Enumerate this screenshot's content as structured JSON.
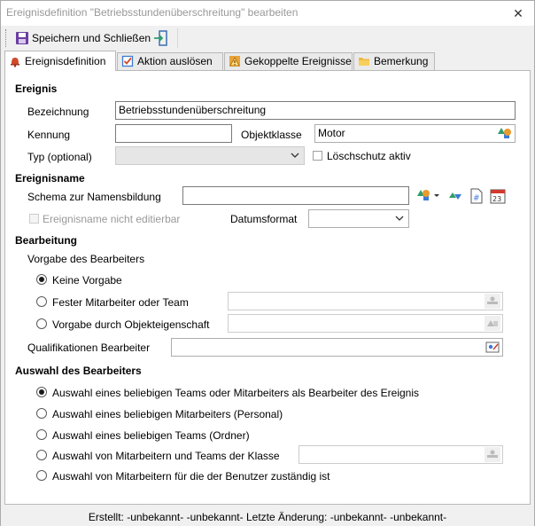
{
  "window": {
    "title": "Ereignisdefinition \"Betriebsstundenüberschreitung\" bearbeiten",
    "close_glyph": "✕"
  },
  "toolbar": {
    "save_label": "Speichern und Schließen",
    "save_icon": "floppy-disk-icon",
    "exit_icon": "exit-door-icon"
  },
  "tabs": [
    {
      "label": "Ereignisdefinition",
      "icon": "bell-icon",
      "active": true
    },
    {
      "label": "Aktion auslösen",
      "icon": "checkbox-icon",
      "active": false
    },
    {
      "label": "Gekoppelte Ereignisse",
      "icon": "warning-icon",
      "active": false
    },
    {
      "label": "Bemerkung",
      "icon": "folder-icon",
      "active": false
    }
  ],
  "ereignis": {
    "section": "Ereignis",
    "bezeichnung_label": "Bezeichnung",
    "bezeichnung_value": "Betriebsstundenüberschreitung",
    "kennung_label": "Kennung",
    "kennung_value": "",
    "objektklasse_label": "Objektklasse",
    "objektklasse_value": "Motor",
    "typ_label": "Typ (optional)",
    "typ_value": "",
    "loeschschutz_label": "Löschschutz aktiv",
    "loeschschutz_checked": false
  },
  "ereignisname": {
    "section": "Ereignisname",
    "schema_label": "Schema zur Namensbildung",
    "schema_value": "",
    "nicht_editierbar_label": "Ereignisname nicht editierbar",
    "datumsformat_label": "Datumsformat",
    "datumsformat_value": "",
    "calendar_day": "23"
  },
  "bearbeitung": {
    "section": "Bearbeitung",
    "vorgabe_label": "Vorgabe des Bearbeiters",
    "options": [
      {
        "label": "Keine Vorgabe",
        "selected": true
      },
      {
        "label": "Fester Mitarbeiter oder Team",
        "selected": false
      },
      {
        "label": "Vorgabe durch Objekteigenschaft",
        "selected": false
      }
    ],
    "qualifikationen_label": "Qualifikationen Bearbeiter",
    "qualifikationen_value": ""
  },
  "auswahl": {
    "section": "Auswahl des Bearbeiters",
    "options": [
      {
        "label": "Auswahl eines beliebigen Teams oder Mitarbeiters als Bearbeiter des Ereignis",
        "selected": true
      },
      {
        "label": "Auswahl eines beliebigen Mitarbeiters (Personal)",
        "selected": false
      },
      {
        "label": "Auswahl eines beliebigen Teams (Ordner)",
        "selected": false
      },
      {
        "label": "Auswahl von Mitarbeitern und Teams der Klasse",
        "selected": false
      },
      {
        "label": "Auswahl von Mitarbeitern für die der Benutzer zuständig ist",
        "selected": false
      }
    ]
  },
  "status": {
    "text": "Erstellt: -unbekannt- -unbekannt-  Letzte Änderung: -unbekannt- -unbekannt-"
  },
  "colors": {
    "accent_green": "#2e9e6e",
    "shape_orange": "#e89a2c",
    "shape_blue": "#3a7bd5",
    "calendar_red": "#d23a2e"
  }
}
